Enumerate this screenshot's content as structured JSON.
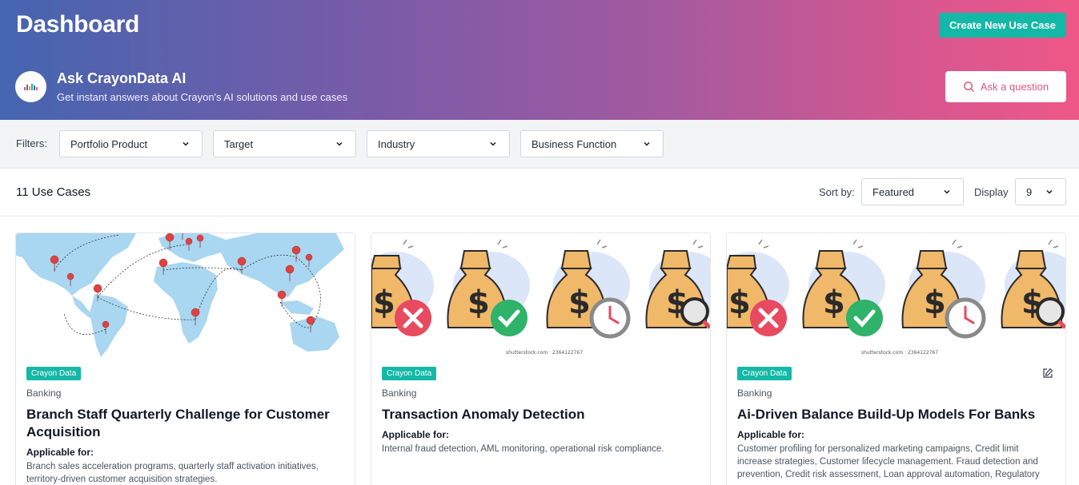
{
  "header": {
    "title": "Dashboard",
    "create_button": "Create New Use Case",
    "ai": {
      "title": "Ask CrayonData AI",
      "subtitle": "Get instant answers about Crayon's AI solutions and use cases",
      "ask_button": "Ask a question"
    }
  },
  "filters": {
    "label": "Filters:",
    "items": [
      {
        "label": "Portfolio Product"
      },
      {
        "label": "Target"
      },
      {
        "label": "Industry"
      },
      {
        "label": "Business Function"
      }
    ]
  },
  "toolbar": {
    "count": "11 Use Cases",
    "sort_label": "Sort by:",
    "sort_value": "Featured",
    "display_label": "Display",
    "display_value": "9"
  },
  "cards": [
    {
      "image": "world-map-with-location-pins",
      "badge": "Crayon Data",
      "industry": "Banking",
      "title": "Branch Staff Quarterly Challenge for Customer Acquisition",
      "applicable_label": "Applicable for:",
      "applicable_text": "Branch sales acceleration programs, quarterly staff activation initiatives, territory-driven customer acquisition strategies."
    },
    {
      "image": "money-bags-status-icons",
      "watermark": "shutterstock.com · 2364122767",
      "badge": "Crayon Data",
      "industry": "Banking",
      "title": "Transaction Anomaly Detection",
      "applicable_label": "Applicable for:",
      "applicable_text": "Internal fraud detection, AML monitoring, operational risk compliance."
    },
    {
      "image": "money-bags-status-icons",
      "watermark": "shutterstock.com · 2364122767",
      "badge": "Crayon Data",
      "industry": "Banking",
      "title": "Ai-Driven Balance Build-Up Models For Banks",
      "applicable_label": "Applicable for:",
      "applicable_text": "Customer profiling for personalized marketing campaigns, Credit limit increase strategies, Customer lifecycle management. Fraud detection and prevention, Credit risk assessment, Loan approval automation, Regulatory"
    }
  ],
  "colors": {
    "accent": "#14b8a6",
    "header_start": "#4565b0",
    "header_end": "#ee5787",
    "ask_text": "#e0557f"
  }
}
